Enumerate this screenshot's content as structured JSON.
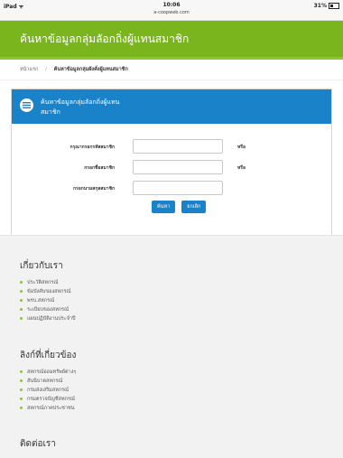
{
  "statusbar": {
    "carrier": "iPad ᯤ",
    "time": "10:06",
    "url": "a-coopweb.com",
    "battery": "31%"
  },
  "header": {
    "title": "ค้นหาข้อมูลกลุ่มลัอกถิ่งผู้แทนสมาชิก"
  },
  "breadcrumb": {
    "home": "หน้าแรก",
    "separator": "/",
    "current": "ค้นหาข้อมูลกลุ่มผังคั่งผู้แทนสมาชิก"
  },
  "panel": {
    "title_line1": "ค้นหาข้อมูลกลุ่มลัอกถิ่งผู้แทน",
    "title_line2": "สมาชิก",
    "fields": [
      {
        "label": "กรุณากรอกรหัสสมาชิก",
        "value": "",
        "suffix": "หรือ"
      },
      {
        "label": "กรอกชื่อสมาชิก",
        "value": "",
        "suffix": "หรือ"
      },
      {
        "label": "กรอกนามสกุลสมาชิก",
        "value": "",
        "suffix": ""
      }
    ],
    "search_button": "ค้นหา",
    "cancel_button": "ยกเลิก"
  },
  "footer": {
    "about": {
      "heading": "เกี่ยวกับเรา",
      "items": [
        "ประวัติสหกรณ์",
        "ข้อบังคับของสหกรณ์",
        "พรบ.สหกรณ์",
        "ระเบียบของสหกรณ์",
        "แผนปฏิบัติงานประจำปี"
      ]
    },
    "links": {
      "heading": "ลิงก์ที่เกี่ยวข้อง",
      "items": [
        "สหกรณ์ออมทรัพย์ต่างๆ",
        "สันนิบาตสหกรณ์",
        "กรมส่งเสริมสหกรณ์",
        "กรมตรวจบัญชีสหกรณ์",
        "สหกรณ์ภาคประชาชน"
      ]
    },
    "contact": {
      "heading": "ติดต่อเรา"
    }
  }
}
